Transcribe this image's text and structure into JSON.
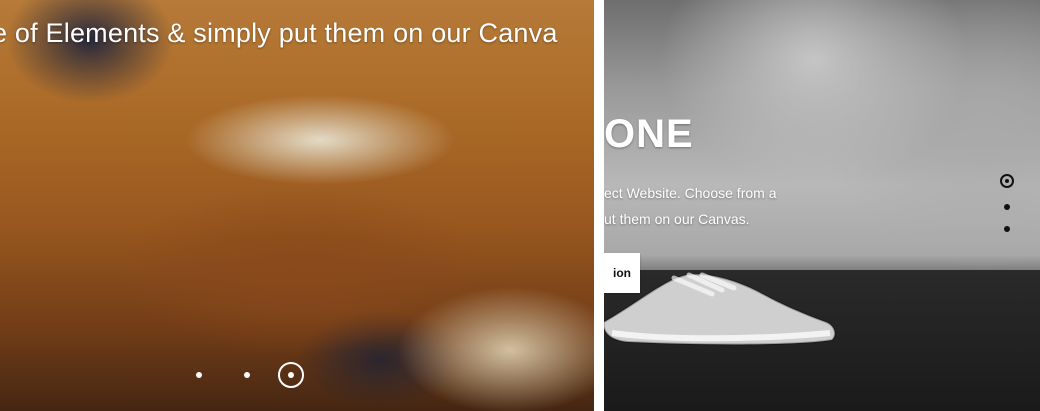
{
  "left_slide": {
    "caption": "e of Elements & simply put them on our Canva",
    "pagination": {
      "count": 3,
      "active_index": 2
    }
  },
  "right_slide": {
    "title": "ONE",
    "subtitle_lines": [
      "ect Website. Choose from a",
      "ut them on our Canvas."
    ],
    "button_label": "ion",
    "pagination": {
      "count": 3,
      "active_index": 0
    }
  },
  "icons": {
    "pagination_dot": "dot-icon",
    "pagination_active": "ring-dot-icon"
  }
}
